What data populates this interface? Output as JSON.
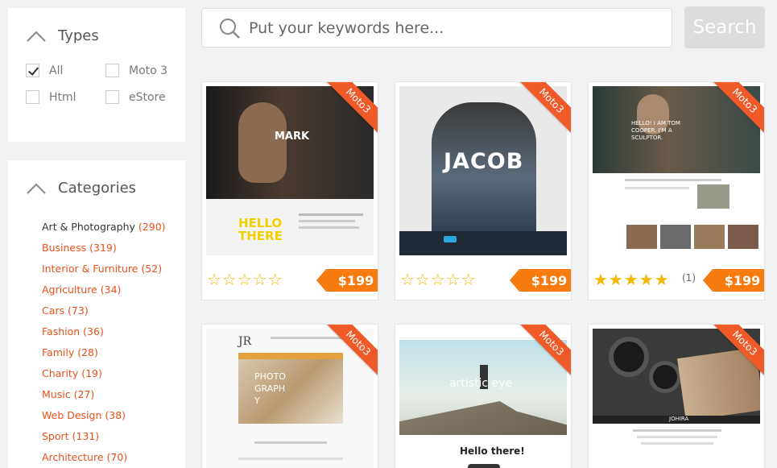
{
  "types": {
    "title": "Types",
    "options": [
      {
        "label": "All",
        "checked": true
      },
      {
        "label": "Moto 3",
        "checked": false
      },
      {
        "label": "Html",
        "checked": false
      },
      {
        "label": "eStore",
        "checked": false
      }
    ]
  },
  "categories": {
    "title": "Categories",
    "items": [
      {
        "name": "Art & Photography",
        "count": "(290)"
      },
      {
        "name": "Business",
        "count": "(319)"
      },
      {
        "name": "Interior & Furniture",
        "count": "(52)"
      },
      {
        "name": "Agriculture",
        "count": "(34)"
      },
      {
        "name": "Cars",
        "count": "(73)"
      },
      {
        "name": "Fashion",
        "count": "(36)"
      },
      {
        "name": "Family",
        "count": "(28)"
      },
      {
        "name": "Charity",
        "count": "(19)"
      },
      {
        "name": "Music",
        "count": "(27)"
      },
      {
        "name": "Web Design",
        "count": "(38)"
      },
      {
        "name": "Sport",
        "count": "(131)"
      },
      {
        "name": "Architecture",
        "count": "(70)"
      }
    ]
  },
  "search": {
    "placeholder": "Put your keywords here...",
    "button": "Search"
  },
  "cards": [
    {
      "ribbon": "Moto3",
      "price": "$199",
      "rating": 0,
      "reviews": "",
      "headline": "MARK",
      "tagline": "HELLO THERE"
    },
    {
      "ribbon": "Moto3",
      "price": "$199",
      "rating": 0,
      "reviews": "",
      "headline": "JACOB"
    },
    {
      "ribbon": "Moto3",
      "price": "$199",
      "rating": 5,
      "reviews": "(1)",
      "headline": "HELLO! I AM TOM COOPER. I'M A SCULPTOR."
    },
    {
      "ribbon": "Moto3",
      "headline": "JR",
      "tagline": "PHOTOGRAPHY"
    },
    {
      "ribbon": "Moto3",
      "headline": "artistic eye",
      "tagline": "Hello there!"
    },
    {
      "ribbon": "Moto3",
      "headline": "JOHIRA"
    }
  ],
  "colors": {
    "accent": "#e8501a",
    "price": "#f77b0e",
    "ribbon": "#f05a28",
    "star": "#f5b800"
  }
}
